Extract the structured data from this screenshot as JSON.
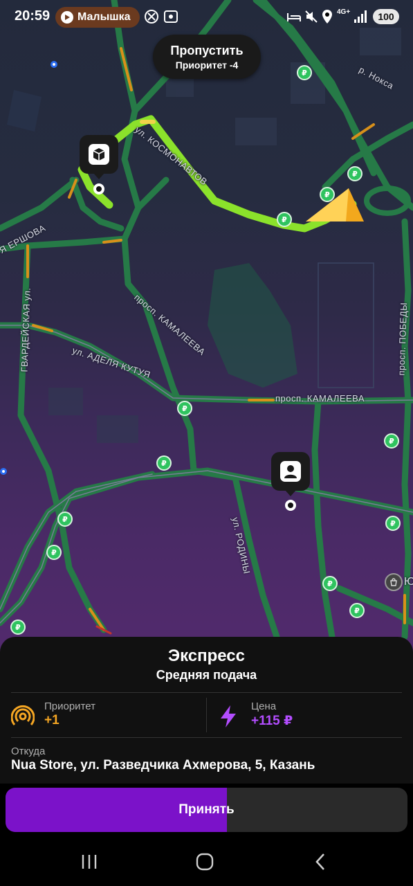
{
  "status_bar": {
    "time": "20:59",
    "media_app": "Малышка",
    "network": "4G+",
    "battery": "100"
  },
  "map": {
    "streets": [
      "ул. КОСМОНАВТОВ",
      "р. Нокса",
      "Я ЕРШОВА",
      "ГВАРДЕЙСКАЯ ул.",
      "просп. КАМАЛЕЕВА",
      "ул. АДЕЛЯ КУТУЯ",
      "просп. КАМАЛЕЕВА",
      "просп. ПОБЕДЫ",
      "ул. РОДИНЫ",
      "Ю"
    ],
    "fuel_icon_label": "₽"
  },
  "skip": {
    "title": "Пропустить",
    "subtitle": "Приоритет -4"
  },
  "order": {
    "title": "Экспресс",
    "subtitle": "Средняя подача",
    "priority_label": "Приоритет",
    "priority_value": "+1",
    "price_label": "Цена",
    "price_value": "+115 ₽",
    "from_label": "Откуда",
    "from_address": "Nua Store, ул. Разведчика Ахмерова, 5, Казань"
  },
  "accept": {
    "label": "Принять",
    "progress_percent": 55
  },
  "colors": {
    "accent_purple": "#7b12c9",
    "priority_icon": "#f5a623",
    "price_purple": "#b34dff",
    "route_green": "#8be22b",
    "road_green": "#2e9a55"
  }
}
